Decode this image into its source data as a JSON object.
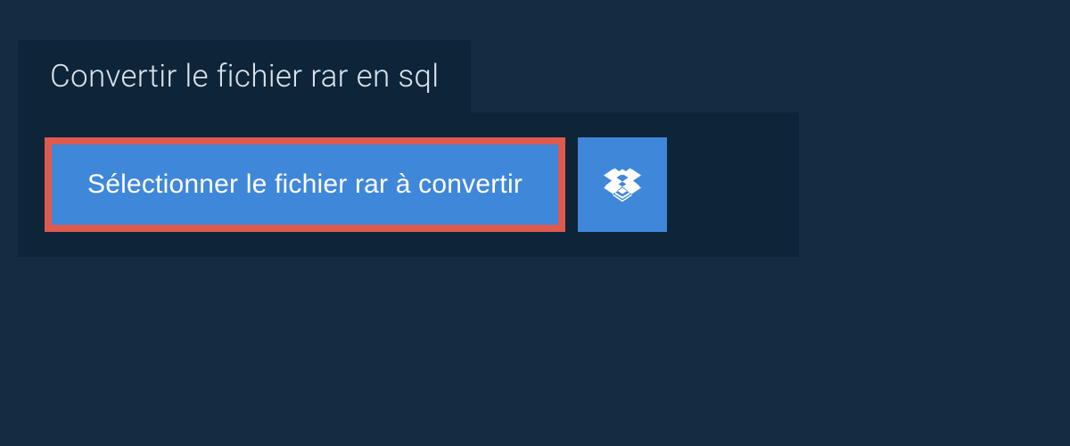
{
  "title": "Convertir le fichier rar en sql",
  "buttons": {
    "select_label": "Sélectionner le fichier rar à convertir"
  },
  "colors": {
    "bg_outer": "#152b42",
    "bg_panel": "#0e2438",
    "button_blue": "#3f87d9",
    "highlight_border": "#de5a4e"
  }
}
